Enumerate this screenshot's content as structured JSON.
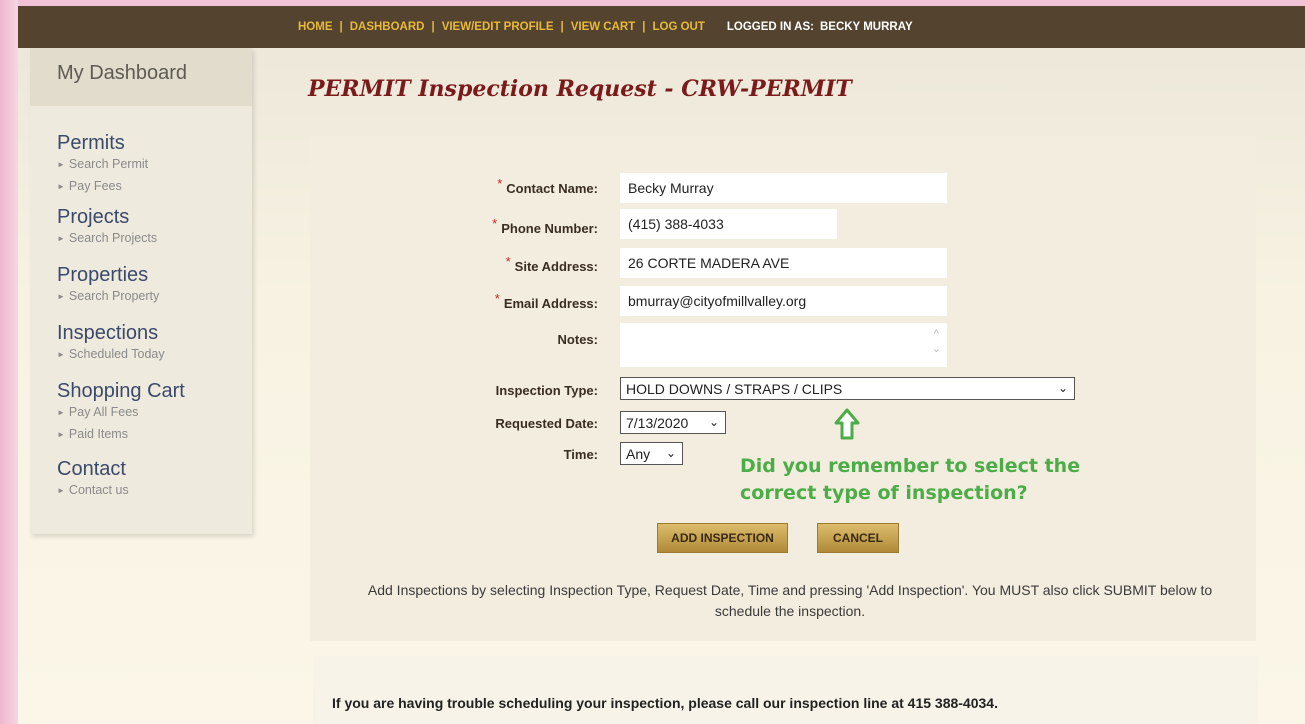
{
  "topnav": {
    "links": [
      "HOME",
      "DASHBOARD",
      "VIEW/EDIT PROFILE",
      "VIEW CART",
      "LOG OUT"
    ],
    "logged_in_label": "LOGGED IN AS:",
    "user_name": "BECKY MURRAY"
  },
  "sidebar": {
    "heading": "My Dashboard",
    "sections": [
      {
        "title": "Permits",
        "items": [
          "Search Permit",
          "Pay Fees"
        ]
      },
      {
        "title": "Projects",
        "items": [
          "Search Projects"
        ]
      },
      {
        "title": "Properties",
        "items": [
          "Search Property"
        ]
      },
      {
        "title": "Inspections",
        "items": [
          "Scheduled Today"
        ]
      },
      {
        "title": "Shopping Cart",
        "items": [
          "Pay All Fees",
          "Paid Items"
        ]
      },
      {
        "title": "Contact",
        "items": [
          "Contact us"
        ]
      }
    ]
  },
  "page_title": "PERMIT Inspection Request - CRW-PERMIT",
  "form": {
    "required_mark": "*",
    "contact_name_label": "Contact Name:",
    "contact_name_value": "Becky Murray",
    "phone_label": "Phone Number:",
    "phone_value": "(415) 388-4033",
    "site_label": "Site Address:",
    "site_value": "26 CORTE MADERA AVE",
    "email_label": "Email Address:",
    "email_value": "bmurray@cityofmillvalley.org",
    "notes_label": "Notes:",
    "notes_value": "",
    "inspection_type_label": "Inspection Type:",
    "inspection_type_value": "HOLD DOWNS / STRAPS / CLIPS",
    "requested_date_label": "Requested Date:",
    "requested_date_value": "7/13/2020",
    "time_label": "Time:",
    "time_value": "Any"
  },
  "hint": {
    "line1": "Did you remember to select the",
    "line2": "correct type of inspection?",
    "color": "#4cad48"
  },
  "buttons": {
    "add": "ADD INSPECTION",
    "cancel": "CANCEL"
  },
  "instructions": "Add Inspections by selecting Inspection Type, Request Date, Time and pressing 'Add Inspection'.  You MUST also click SUBMIT below to schedule the inspection.",
  "trouble_text": "If you are having trouble scheduling your inspection, please call our inspection line at 415 388-4034."
}
